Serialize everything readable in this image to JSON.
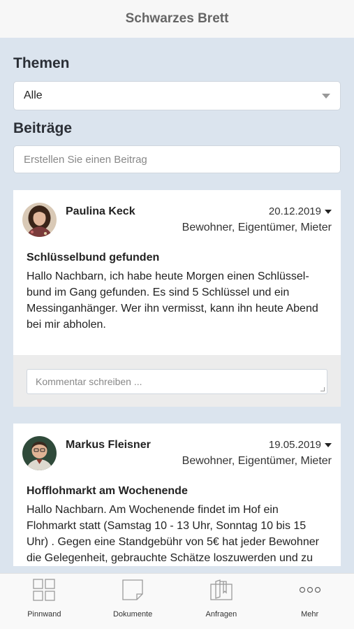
{
  "header": {
    "title": "Schwarzes Brett"
  },
  "themen": {
    "heading": "Themen",
    "selected": "Alle"
  },
  "beitraege": {
    "heading": "Beiträge",
    "placeholder": "Erstellen Sie einen Beitrag"
  },
  "posts": [
    {
      "author": "Paulina Keck",
      "date": "20.12.2019",
      "audience": "Bewohner, Eigentümer, Mieter",
      "title": "Schlüsselbund gefunden",
      "text": "Hallo Nachbarn, ich habe heute Morgen einen Schlüssel-\nbund im Gang gefunden. Es sind 5 Schlüssel und ein\nMessinganhänger. Wer ihn vermisst, kann ihn heute Abend\nbei mir abholen.",
      "comment_placeholder": "Kommentar schreiben ..."
    },
    {
      "author": "Markus Fleisner",
      "date": "19.05.2019",
      "audience": "Bewohner, Eigentümer, Mieter",
      "title": "Hofflohmarkt am Wochenende",
      "text": "Hallo Nachbarn. Am Wochenende findet im Hof ein\nFlohmarkt statt (Samstag 10 - 13 Uhr, Sonntag 10 bis 15\nUhr) . Gegen eine Standgebühr von 5€ hat jeder Bewohner\ndie Gelegenheit, gebrauchte Schätze loszuwerden und zu"
    }
  ],
  "tabbar": {
    "items": [
      {
        "label": "Pinnwand",
        "icon": "grid-icon"
      },
      {
        "label": "Dokumente",
        "icon": "document-icon"
      },
      {
        "label": "Anfragen",
        "icon": "requests-icon"
      },
      {
        "label": "Mehr",
        "icon": "more-icon"
      }
    ]
  }
}
